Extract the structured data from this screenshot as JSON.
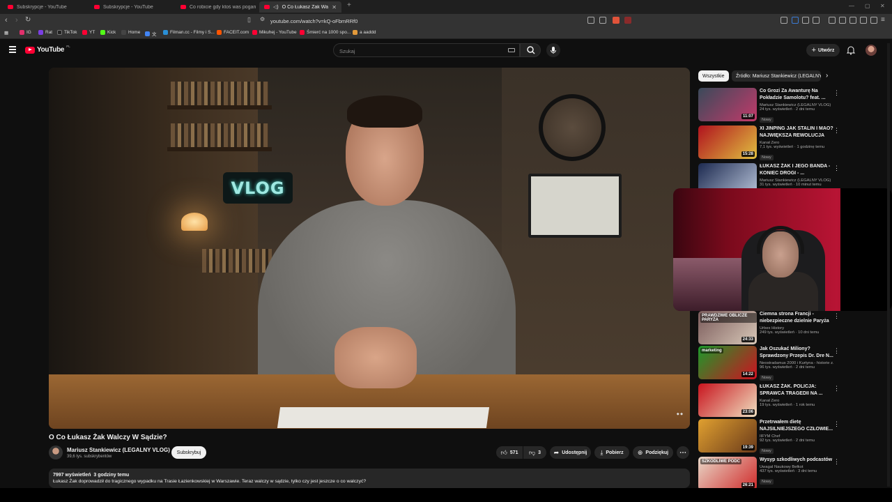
{
  "tabs": [
    {
      "title": "Subskrypcje - YouTube",
      "active": false
    },
    {
      "title": "Subskrypcje - YouTube",
      "active": false
    },
    {
      "title": "Co robicie gdy ktoś was pogania dri...",
      "active": false
    },
    {
      "title": "O Co Łukasz Żak Walczy W S...",
      "active": true
    }
  ],
  "address": {
    "url": "youtube.com/watch?v=kQ-oFbmRRf0"
  },
  "bookmarks": [
    {
      "label": "IG",
      "color": "#e1306c"
    },
    {
      "label": "Rat",
      "color": "#7b3fe4"
    },
    {
      "label": "TikTok",
      "color": "#222222"
    },
    {
      "label": "YT",
      "color": "#ff0033"
    },
    {
      "label": "Kick",
      "color": "#53fc18"
    },
    {
      "label": "Home",
      "color": "#444444"
    },
    {
      "label": "文",
      "color": "#4285f4"
    },
    {
      "label": "Filman.cc - Filmy i S...",
      "color": "#2a8fd6"
    },
    {
      "label": "FACEIT.com",
      "color": "#ff5500"
    },
    {
      "label": "Mikuhej - YouTube",
      "color": "#ff0033"
    },
    {
      "label": "Śmierć na 1000 spo...",
      "color": "#ff0033"
    },
    {
      "label": "a aaddd",
      "color": "#e39a3b"
    }
  ],
  "youtube": {
    "logo_text": "YouTube",
    "region": "PL",
    "search_placeholder": "Szukaj",
    "create_label": "Utwórz"
  },
  "video": {
    "title": "O Co Łukasz Żak Walczy W Sądzie?",
    "channel": "Mariusz Stankiewicz (LEGALNY VLOG)",
    "subscribers": "39,6 tys. subskrybentów",
    "subscribe_label": "Subskrybuj",
    "likes": "571",
    "dislikes": "3",
    "share_label": "Udostępnij",
    "download_label": "Pobierz",
    "thanks_label": "Podziękuj",
    "sign_text": "VLOG",
    "views": "7997 wyświetleń",
    "posted": "3 godziny temu",
    "description": "Łukasz Żak doprowadził do tragicznego wypadku na Trasie Łazienkowskiej w Warszawie. Teraz walczy w sądzie, tylko czy jest jeszcze o co walczyć?"
  },
  "chips": [
    {
      "label": "Wszystkie",
      "active": true
    },
    {
      "label": "Źródło: Mariusz Stankiewicz (LEGALNY VLOG)",
      "active": false
    }
  ],
  "recommendations": [
    {
      "title": "Co Grozi Za Awanturę Na Pokładzie Samolotu? feat. ...",
      "channel": "Mariusz Stankiewicz (LEGALNY VLOG)",
      "meta": "24 tys. wyświetleń · 2 dni temu",
      "badge": "Nowy",
      "duration": "11:07",
      "thumb": [
        "#3a4a5a",
        "#c23a6a"
      ]
    },
    {
      "title": "XI JINPING JAK STALIN I MAO? NAJWIĘKSZA REWOLUCJA O...",
      "channel": "Kanał Zero",
      "meta": "7,1 tys. wyświetleń · 1 godzinę temu",
      "badge": "Nowy",
      "duration": "15:28",
      "thumb": [
        "#b0121e",
        "#e0c040"
      ]
    },
    {
      "title": "ŁUKASZ ŻAK I JEGO BANDA - KONIEC DROGI - ...",
      "channel": "Mariusz Stankiewicz (LEGALNY VLOG)",
      "meta": "31 tys. wyświetleń · 10 minut temu",
      "badge": "",
      "duration": "",
      "thumb": [
        "#1d2a50",
        "#b7c3d8"
      ]
    },
    {
      "title": "Ciemna strona Francji - niebezpieczne dzielnie Paryża",
      "channel": "Urbex History",
      "meta": "249 tys. wyświetleń · 10 dni temu",
      "badge": "",
      "duration": "24:33",
      "thumb": [
        "#7a5a5a",
        "#d8c8b8"
      ]
    },
    {
      "title": "Jak Oszukać Miliony? Sprawdzony Przepis Dr. Dre N...",
      "channel": "Neostradamus 2000 i Kurtyna - historie z...",
      "meta": "96 tys. wyświetleń · 2 dni temu",
      "badge": "Nowy",
      "duration": "14:22",
      "thumb": [
        "#1a9a2a",
        "#d01020"
      ]
    },
    {
      "title": "ŁUKASZ ŻAK. POLICJA: SPRAWCA TRAGEDII NA ...",
      "channel": "Kanał Zero",
      "meta": "19 tys. wyświetleń · 1 rok temu",
      "badge": "",
      "duration": "23:06",
      "thumb": [
        "#c8141e",
        "#f0e0c0"
      ]
    },
    {
      "title": "Przetrwałem dietę NAJSILNIEJSZEGO CZŁOWIE...",
      "channel": "IIFYM Chef",
      "meta": "92 tys. wyświetleń · 2 dni temu",
      "badge": "Nowy",
      "duration": "19:39",
      "thumb": [
        "#e0a030",
        "#6a3a1a"
      ]
    },
    {
      "title": "Wysyp szkodliwych podcastów",
      "channel": "Uwagal Naukowy Bełkot",
      "meta": "437 tys. wyświetleń · 3 dni temu",
      "badge": "Nowy",
      "duration": "26:21",
      "thumb": [
        "#e8d8c8",
        "#d02a2a"
      ]
    }
  ],
  "thumb_captions": {
    "rec4": "PRAWDZIWE OBLICZE PARYŻA",
    "rec5": "marketing",
    "rec8": "SZKODLIWE PODC"
  },
  "colors": {
    "yt_red": "#ff0033",
    "background": "#0f0f0f",
    "surface": "#272727"
  }
}
